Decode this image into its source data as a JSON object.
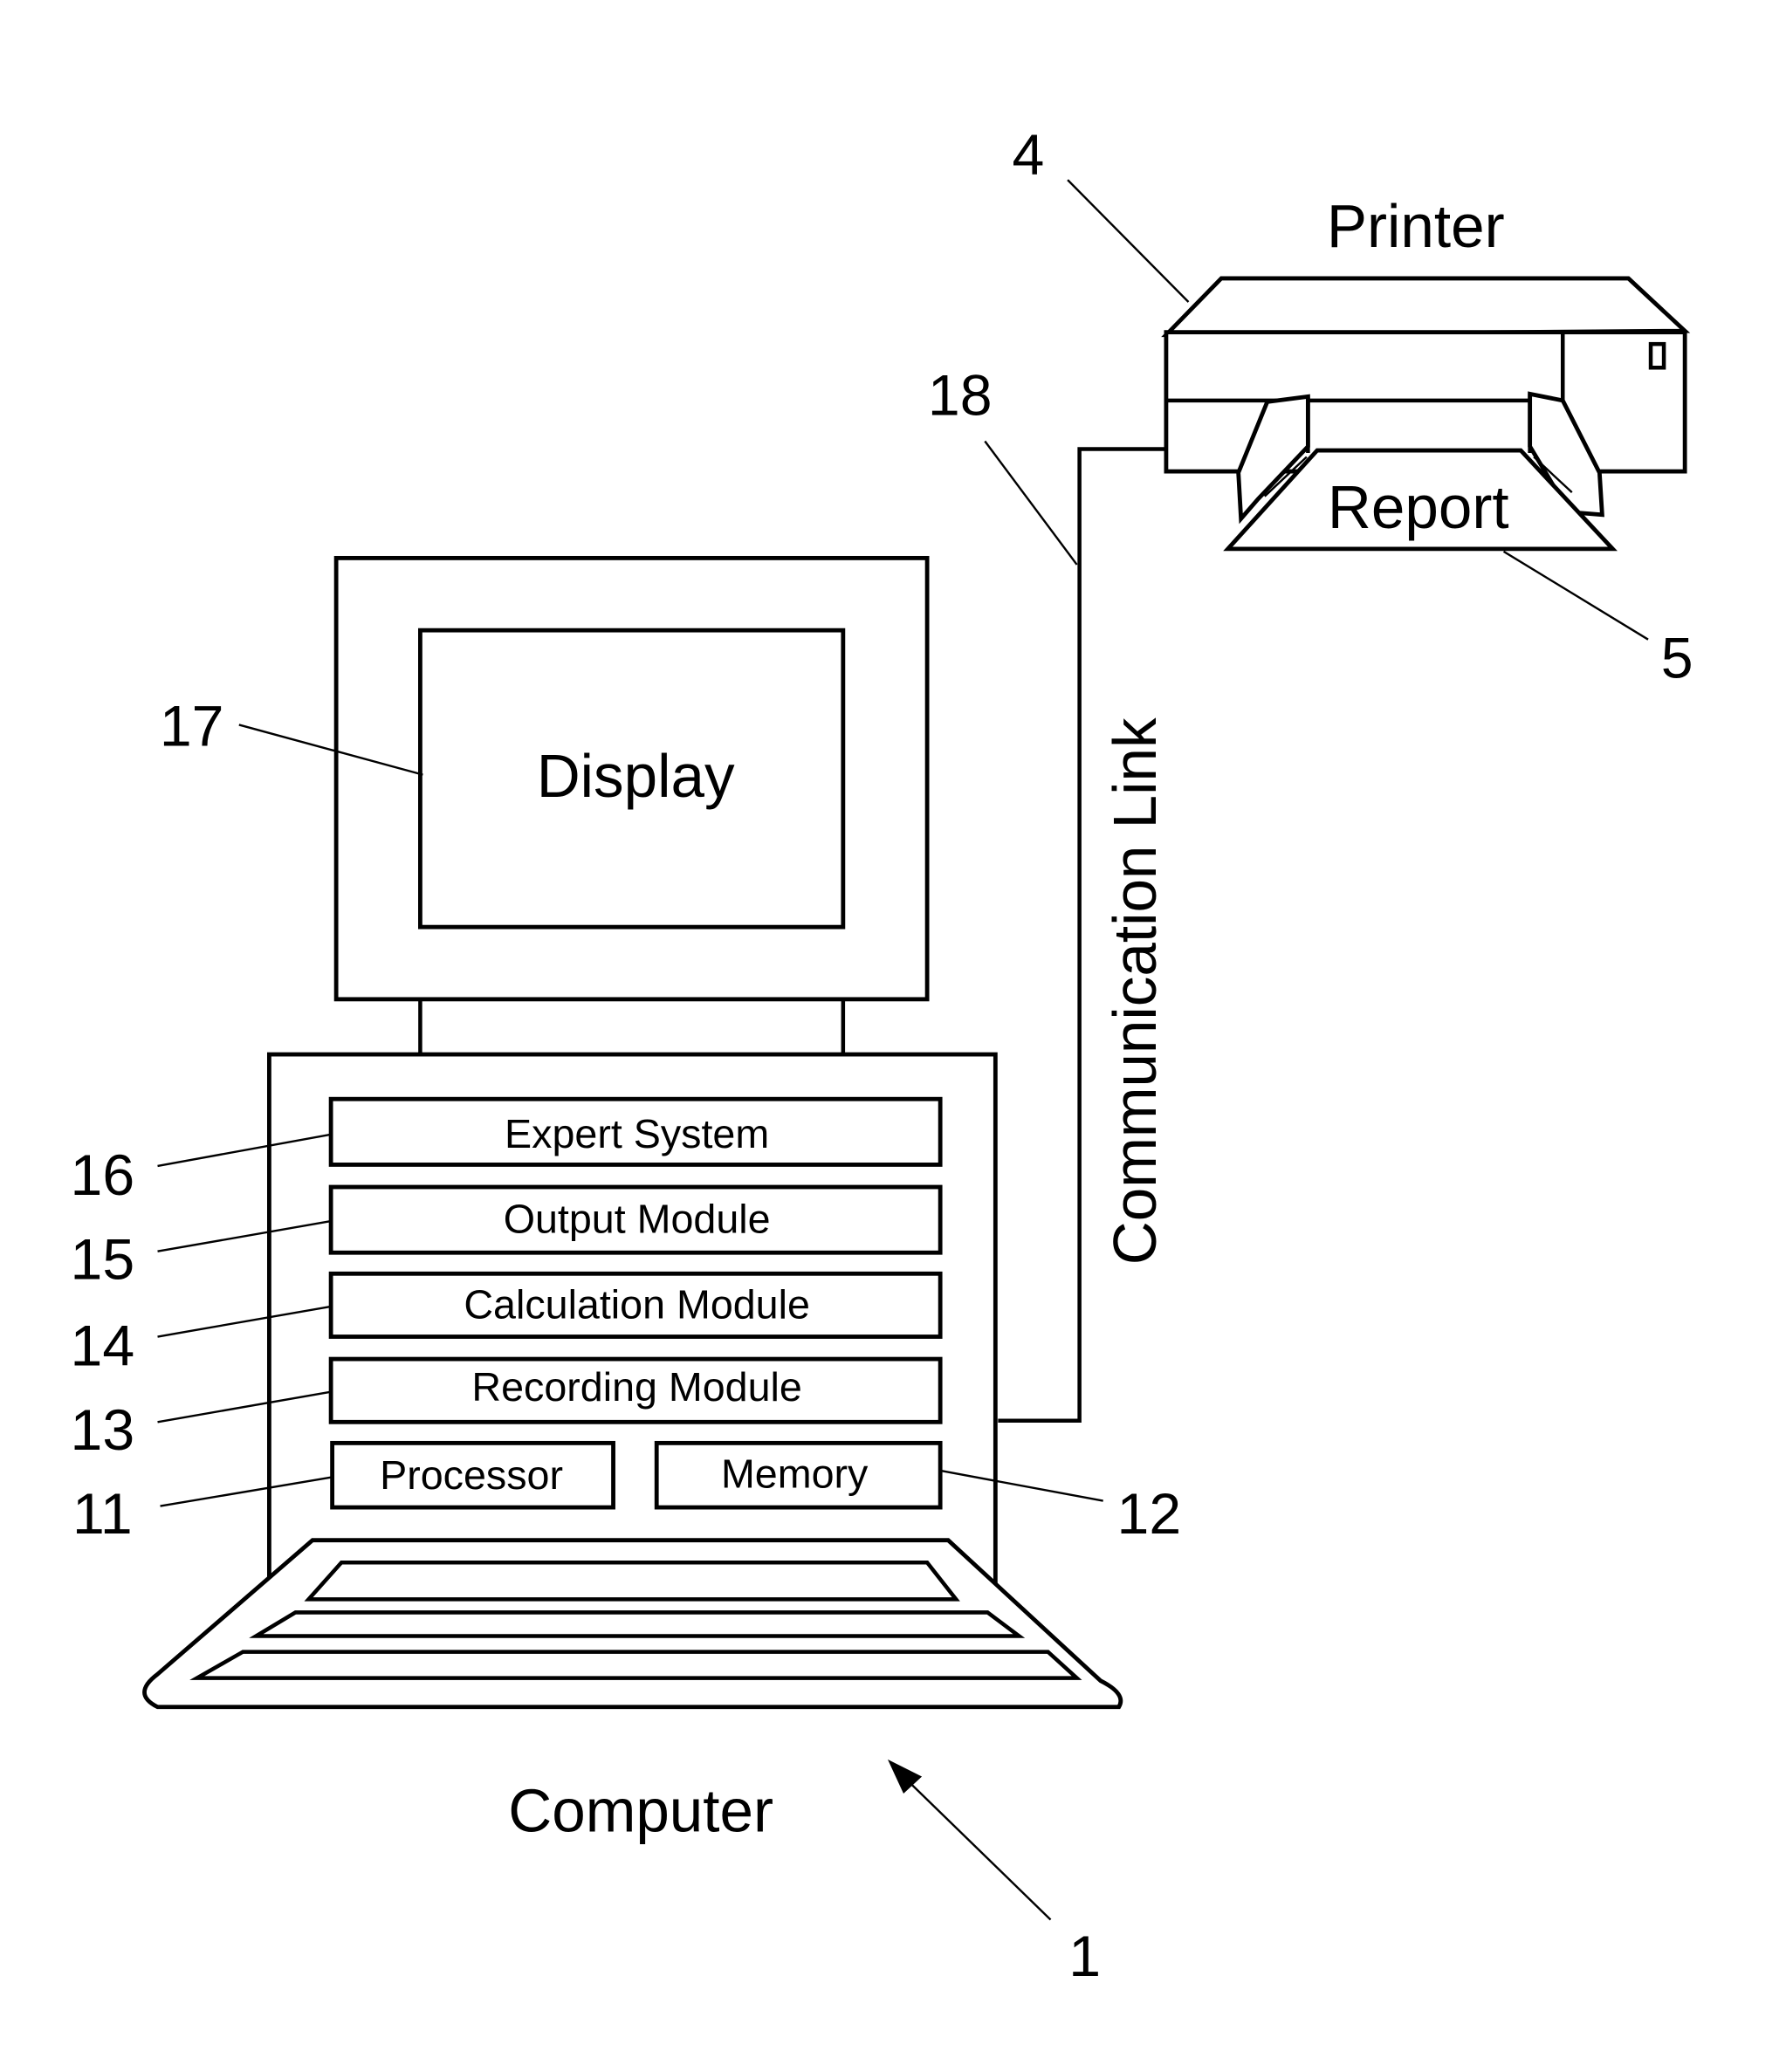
{
  "figure": {
    "type": "block-diagram",
    "description": "Computer system connected to a printer via a communication link"
  },
  "printer": {
    "label": "Printer",
    "ref": "4",
    "output": {
      "label": "Report",
      "ref": "5"
    }
  },
  "link": {
    "label": "Communication Link",
    "ref": "18"
  },
  "display": {
    "label": "Display",
    "ref": "17"
  },
  "computer": {
    "label": "Computer",
    "ref": "1",
    "modules": [
      {
        "label": "Expert System",
        "ref": "16"
      },
      {
        "label": "Output Module",
        "ref": "15"
      },
      {
        "label": "Calculation Module",
        "ref": "14"
      },
      {
        "label": "Recording Module",
        "ref": "13"
      }
    ],
    "processor": {
      "label": "Processor",
      "ref": "11"
    },
    "memory": {
      "label": "Memory",
      "ref": "12"
    }
  }
}
